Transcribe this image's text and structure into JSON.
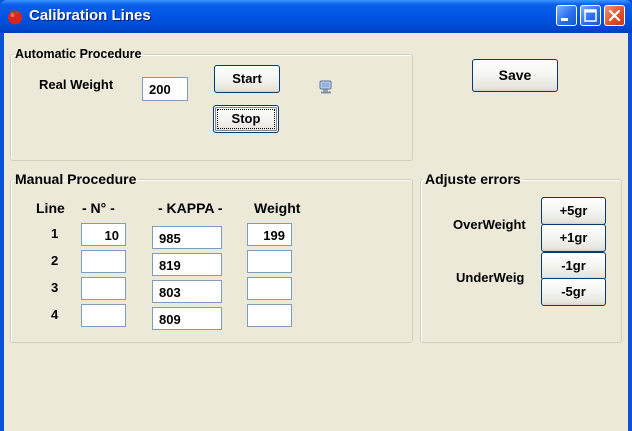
{
  "window": {
    "title": "Calibration Lines"
  },
  "colors": {
    "titlebar": "#0054e3",
    "client": "#ece9d8",
    "close_button": "#e2522a"
  },
  "auto": {
    "legend": "Automatic Procedure",
    "real_weight_label": "Real Weight",
    "real_weight_value": "200",
    "start_label": "Start",
    "stop_label": "Stop",
    "status_icon": "computer-icon"
  },
  "save_label": "Save",
  "manual": {
    "legend": "Manual Procedure",
    "headers": {
      "line": "Line",
      "n": "- N° -",
      "kappa": "- KAPPA -",
      "weight": "Weight"
    },
    "rows": [
      {
        "line": "1",
        "n": "10",
        "kappa": "985",
        "weight": "199"
      },
      {
        "line": "2",
        "n": "",
        "kappa": "819",
        "weight": ""
      },
      {
        "line": "3",
        "n": "",
        "kappa": "803",
        "weight": ""
      },
      {
        "line": "4",
        "n": "",
        "kappa": "809",
        "weight": ""
      }
    ]
  },
  "adjust": {
    "legend": "Adjuste errors",
    "over_label": "OverWeight",
    "under_label": "UnderWeig",
    "buttons": {
      "plus5": "+5gr",
      "plus1": "+1gr",
      "minus1": "-1gr",
      "minus5": "-5gr"
    }
  }
}
